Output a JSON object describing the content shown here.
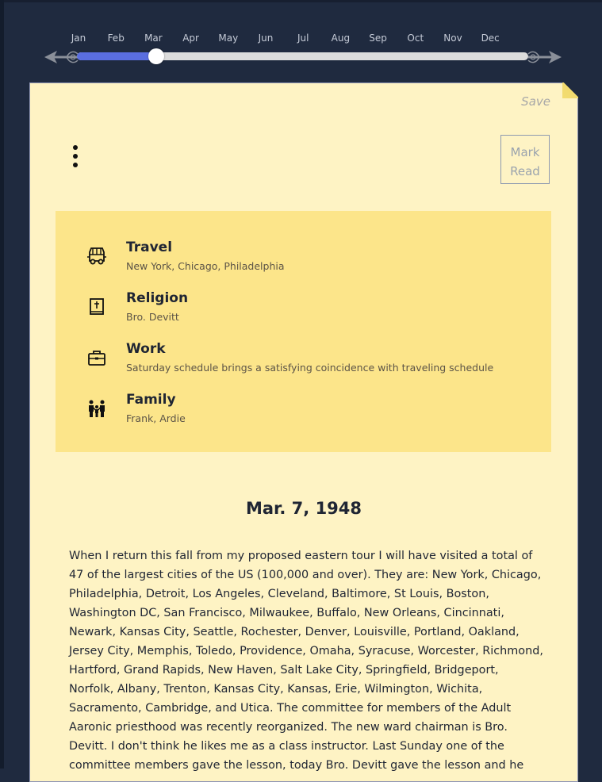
{
  "timeline": {
    "months": [
      "Jan",
      "Feb",
      "Mar",
      "Apr",
      "May",
      "Jun",
      "Jul",
      "Aug",
      "Sep",
      "Oct",
      "Nov",
      "Dec"
    ],
    "selected_month": "Mar",
    "accent_color": "#5a6ee0"
  },
  "card": {
    "save_label": "Save",
    "mark_read_label": "Mark Read",
    "tags": [
      {
        "icon": "van-icon",
        "title": "Travel",
        "detail": "New York, Chicago, Philadelphia"
      },
      {
        "icon": "bible-icon",
        "title": "Religion",
        "detail": "Bro. Devitt"
      },
      {
        "icon": "briefcase-icon",
        "title": "Work",
        "detail": "Saturday schedule brings a satisfying coincidence with traveling schedule"
      },
      {
        "icon": "family-icon",
        "title": "Family",
        "detail": "Frank, Ardie"
      }
    ],
    "entry_date": "Mar. 7, 1948",
    "entry_text": "When I return this fall from my proposed eastern tour I will have visited a total of 47 of the largest cities of the US (100,000 and over). They are: New York, Chicago, Philadelphia, Detroit, Los Angeles, Cleveland, Baltimore, St Louis, Boston, Washington DC, San Francisco, Milwaukee, Buffalo, New Orleans, Cincinnati, Newark, Kansas City, Seattle, Rochester, Denver, Louisville, Portland, Oakland, Jersey City, Memphis, Toledo, Providence, Omaha, Syracuse, Worcester, Richmond, Hartford, Grand Rapids, New Haven, Salt Lake City, Springfield, Bridgeport, Norfolk, Albany, Trenton, Kansas City, Kansas, Erie, Wilmington, Wichita, Sacramento, Cambridge, and Utica. The committee for members of the Adult Aaronic priesthood was recently reorganized. The new ward chairman is Bro. Devitt. I don't think he likes me as a class instructor. Last Sunday one of the committee members gave the lesson, today Bro. Devitt gave the lesson and he"
  }
}
